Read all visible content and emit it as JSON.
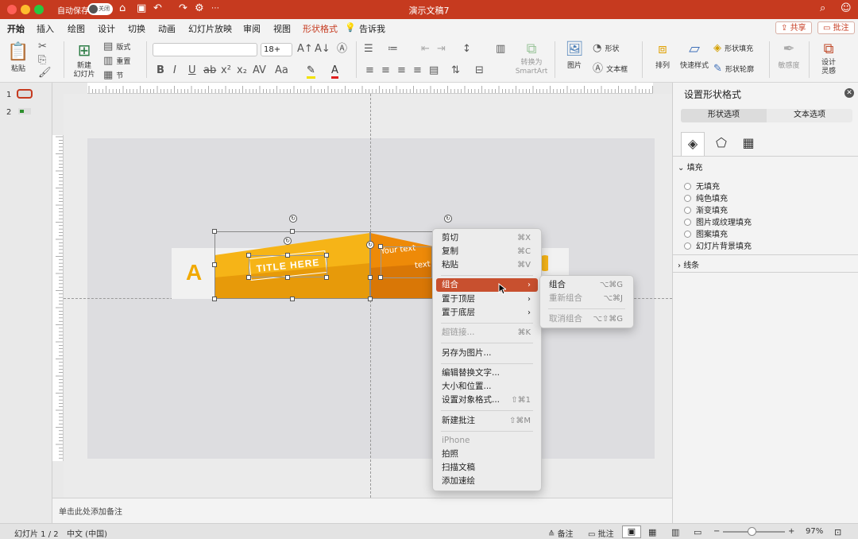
{
  "window": {
    "title": "演示文稿7",
    "autosave_label": "自动保存",
    "autosave_state": "关闭"
  },
  "tabs": [
    "开始",
    "插入",
    "绘图",
    "设计",
    "切换",
    "动画",
    "幻灯片放映",
    "审阅",
    "视图",
    "形状格式"
  ],
  "tell_me": "告诉我",
  "share_button": "共享",
  "comment_button": "批注",
  "ribbon": {
    "paste": "粘贴",
    "new_slide": "新建\n幻灯片",
    "layout": "版式",
    "reset": "重置",
    "section": "节",
    "font_size": "18+",
    "convert_smartart": "转换为\nSmartArt",
    "picture": "图片",
    "shapes": "形状",
    "textbox": "文本框",
    "arrange": "排列",
    "quick_styles": "快速样式",
    "shape_fill": "形状填充",
    "shape_outline": "形状轮廓",
    "sensitivity": "敏感度",
    "designer": "设计\n灵感"
  },
  "slides": {
    "items": [
      {
        "number": "1"
      },
      {
        "number": "2"
      }
    ]
  },
  "slide_content": {
    "letter": "A",
    "title_text": "TITLE HERE",
    "your_text": "Your text",
    "text_cut": "text"
  },
  "notes_placeholder": "单击此处添加备注",
  "status": {
    "slide_indicator": "幻灯片 1 / 2",
    "language": "中文 (中国)",
    "notes": "备注",
    "comments": "批注",
    "zoom": "97%"
  },
  "format_pane": {
    "title": "设置形状格式",
    "tab_shape": "形状选项",
    "tab_text": "文本选项",
    "fill_section": "填充",
    "fill_options": [
      "无填充",
      "纯色填充",
      "渐变填充",
      "图片或纹理填充",
      "图案填充",
      "幻灯片背景填充"
    ],
    "line_section": "线条"
  },
  "context_menu": {
    "items": [
      {
        "label": "剪切",
        "shortcut": "⌘X"
      },
      {
        "label": "复制",
        "shortcut": "⌘C"
      },
      {
        "label": "粘贴",
        "shortcut": "⌘V"
      },
      {
        "label": "组合",
        "shortcut": ""
      },
      {
        "label": "置于顶层",
        "shortcut": ""
      },
      {
        "label": "置于底层",
        "shortcut": ""
      },
      {
        "label": "超链接...",
        "shortcut": "⌘K"
      },
      {
        "label": "另存为图片...",
        "shortcut": ""
      },
      {
        "label": "编辑替换文字...",
        "shortcut": ""
      },
      {
        "label": "大小和位置...",
        "shortcut": ""
      },
      {
        "label": "设置对象格式...",
        "shortcut": "⇧⌘1"
      },
      {
        "label": "新建批注",
        "shortcut": "⇧⌘M"
      },
      {
        "label": "iPhone",
        "shortcut": ""
      },
      {
        "label": "拍照",
        "shortcut": ""
      },
      {
        "label": "扫描文稿",
        "shortcut": ""
      },
      {
        "label": "添加速绘",
        "shortcut": ""
      }
    ]
  },
  "submenu": {
    "items": [
      {
        "label": "组合",
        "shortcut": "⌥⌘G"
      },
      {
        "label": "重新组合",
        "shortcut": "⌥⌘J"
      },
      {
        "label": "取消组合",
        "shortcut": "⌥⇧⌘G"
      }
    ]
  },
  "colors": {
    "brand": "#c63a1f",
    "highlight": "#c8502f",
    "banner_yellow": "#f6b417",
    "banner_orange": "#e98a06"
  }
}
